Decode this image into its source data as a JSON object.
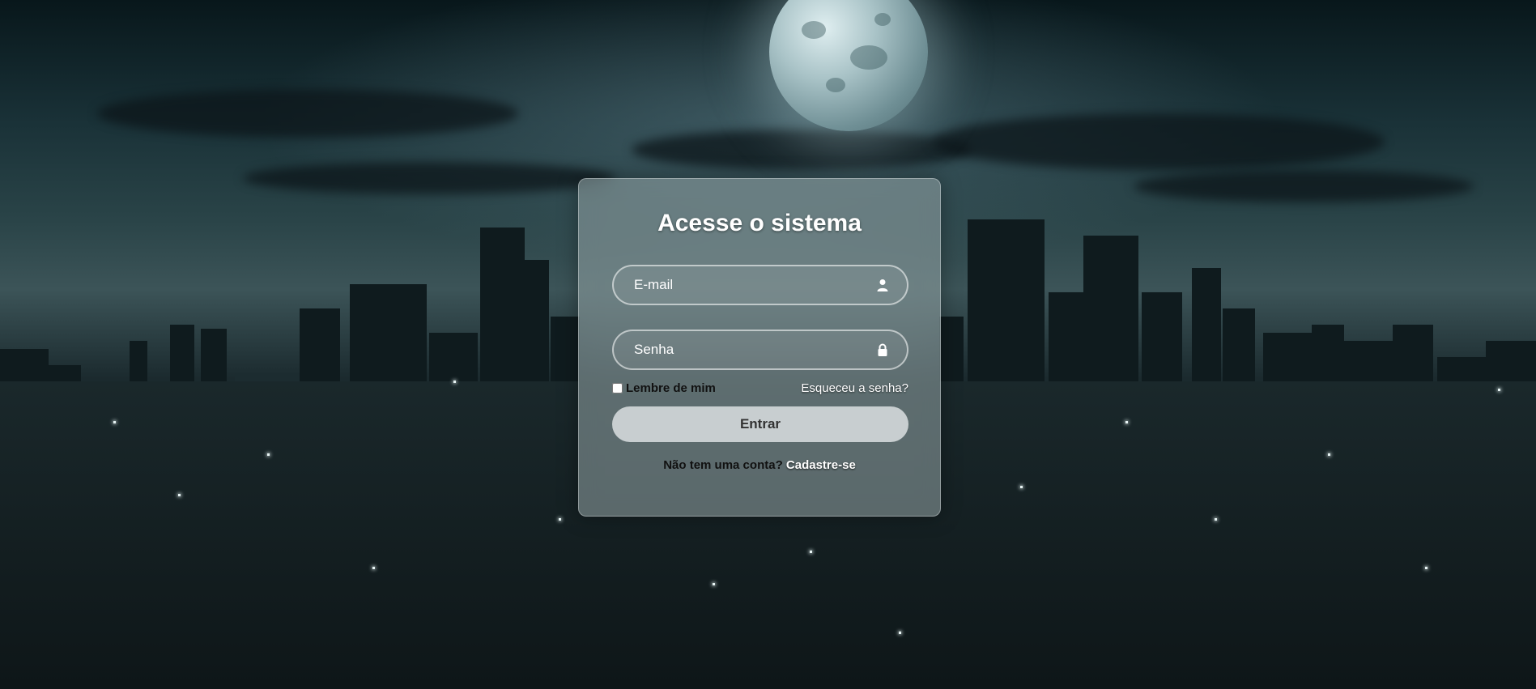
{
  "login": {
    "title": "Acesse o sistema",
    "email_placeholder": "E-mail",
    "password_placeholder": "Senha",
    "remember_label": "Lembre de mim",
    "forgot_link": "Esqueceu a senha?",
    "submit_label": "Entrar",
    "register_prompt": "Não tem uma conta?",
    "register_link": "Cadastre-se",
    "email_icon": "user-icon",
    "password_icon": "lock-icon"
  },
  "background": {
    "description_icon": "night-city-moon-background"
  },
  "colors": {
    "card_bg": "#96a5a8",
    "button_bg": "#dce1e2",
    "text_light": "#ffffff",
    "text_dark": "#111111"
  }
}
